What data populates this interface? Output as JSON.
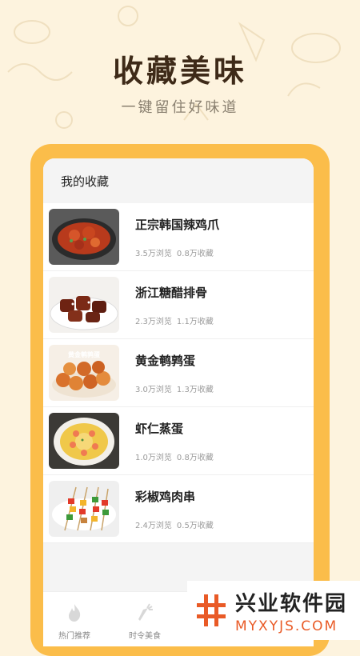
{
  "hero": {
    "title": "收藏美味",
    "subtitle": "一键留住好味道"
  },
  "screen": {
    "header_title": "我的收藏",
    "favorites": [
      {
        "title": "正宗韩国辣鸡爪",
        "views": "3.5万浏览",
        "saves": "0.8万收藏",
        "image": "spicy-chicken-feet-pan"
      },
      {
        "title": "浙江糖醋排骨",
        "views": "2.3万浏览",
        "saves": "1.1万收藏",
        "image": "sweet-sour-ribs"
      },
      {
        "title": "黄金鹌鹑蛋",
        "views": "3.0万浏览",
        "saves": "1.3万收藏",
        "image": "golden-quail-eggs",
        "image_text": "黄金鹌鹑蛋"
      },
      {
        "title": "虾仁蒸蛋",
        "views": "1.0万浏览",
        "saves": "0.8万收藏",
        "image": "shrimp-steamed-egg"
      },
      {
        "title": "彩椒鸡肉串",
        "views": "2.4万浏览",
        "saves": "0.5万收藏",
        "image": "pepper-chicken-skewers"
      }
    ]
  },
  "tabbar": {
    "tabs": [
      {
        "label": "热门推荐",
        "icon": "flame-icon"
      },
      {
        "label": "时令美食",
        "icon": "carrot-icon"
      }
    ]
  },
  "watermark": {
    "logo_glyph": "#",
    "name": "兴业软件园",
    "url": "MYXYJS.COM"
  },
  "colors": {
    "background": "#fdf3de",
    "phone_frame": "#fbbd4a",
    "title": "#3e2a18",
    "watermark_accent": "#e95a26"
  }
}
